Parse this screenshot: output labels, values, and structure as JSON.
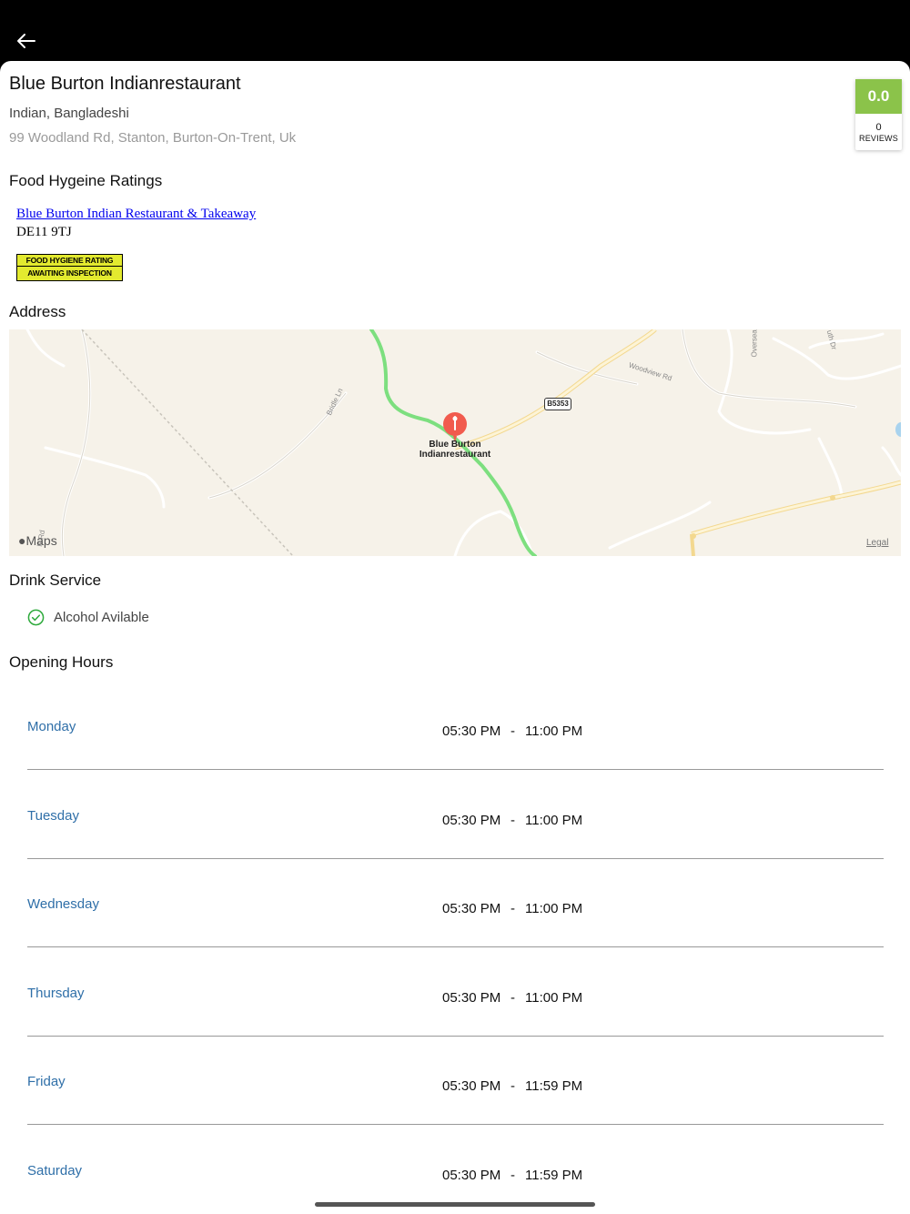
{
  "restaurant": {
    "name": "Blue Burton Indianrestaurant",
    "cuisine": "Indian, Bangladeshi",
    "address": "99 Woodland Rd, Stanton, Burton-On-Trent, Uk"
  },
  "rating": {
    "score": "0.0",
    "reviews_count": "0",
    "reviews_label": "REVIEWS",
    "accent_color": "#8bc34a"
  },
  "sections": {
    "food_hygiene": "Food Hygeine Ratings",
    "address": "Address",
    "drink_service": "Drink Service",
    "opening_hours": "Opening Hours"
  },
  "food_hygiene": {
    "link_text": "Blue Burton Indian Restaurant & Takeaway",
    "postcode": "DE11 9TJ",
    "badge_top": "FOOD HYGIENE RATING",
    "badge_bottom": "AWAITING INSPECTION"
  },
  "map": {
    "pin_label_line1": "Blue Burton",
    "pin_label_line2": "Indianrestaurant",
    "road_shield": "B5353",
    "roads": [
      "Woodview Rd",
      "Bridle Ln",
      "Overseal",
      "uth Dr",
      "ls Rd"
    ],
    "logo": "Maps",
    "legal": "Legal"
  },
  "drink_service": {
    "alcohol": "Alcohol Avilable"
  },
  "opening_hours": [
    {
      "day": "Monday",
      "open": "05:30 PM",
      "close": "11:00 PM"
    },
    {
      "day": "Tuesday",
      "open": "05:30 PM",
      "close": "11:00 PM"
    },
    {
      "day": "Wednesday",
      "open": "05:30 PM",
      "close": "11:00 PM"
    },
    {
      "day": "Thursday",
      "open": "05:30 PM",
      "close": "11:00 PM"
    },
    {
      "day": "Friday",
      "open": "05:30 PM",
      "close": "11:59 PM"
    },
    {
      "day": "Saturday",
      "open": "05:30 PM",
      "close": "11:59 PM"
    }
  ],
  "hours_separator": "-",
  "icons": {
    "back": "arrow-left-icon",
    "check": "check-circle-icon",
    "pin": "map-pin-icon"
  },
  "colors": {
    "day_text": "#2f6fa8",
    "check": "#2eaa3c",
    "route": "#7ddf7f"
  }
}
